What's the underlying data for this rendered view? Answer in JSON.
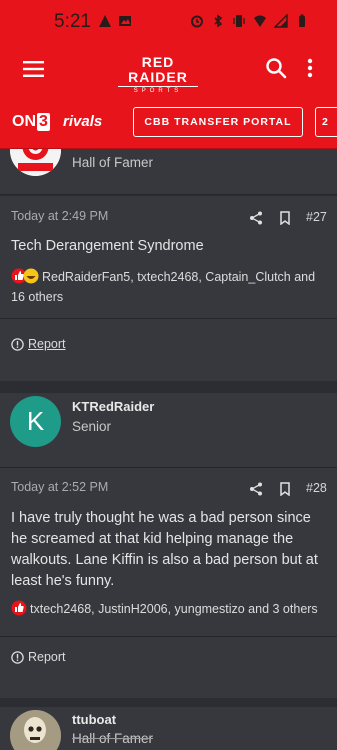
{
  "status_bar": {
    "time": "5:21"
  },
  "brand": {
    "logo_line1": "RED RAIDER",
    "logo_line2": "SPORTS"
  },
  "partner_bar": {
    "on3_prefix": "ON",
    "on3_digit": "3",
    "rivals": "rivals",
    "portal_button": "CBB TRANSFER PORTAL",
    "next_button": "2"
  },
  "posts": [
    {
      "role": "Hall of Famer",
      "time": "Today at 2:49 PM",
      "number": "#27",
      "body": "Tech Derangement Syndrome",
      "reactions": "RedRaiderFan5, txtech2468, Captain_Clutch and 16 others",
      "report": "Report"
    },
    {
      "username": "KTRedRaider",
      "avatar_letter": "K",
      "role": "Senior",
      "time": "Today at 2:52 PM",
      "number": "#28",
      "body": "I have truly thought he was a bad person since he screamed at that kid helping manage the walkouts. Lane Kiffin is also a bad person but at least he's funny.",
      "reactions": "txtech2468, JustinH2006, yungmestizo and 3 others",
      "report": "Report"
    },
    {
      "username": "ttuboat",
      "role": "Hall of Famer"
    }
  ],
  "colors": {
    "brand_red": "#e8141c",
    "avatar_teal": "#1e9b89",
    "background": "#2b2d33",
    "card": "#36383e"
  }
}
